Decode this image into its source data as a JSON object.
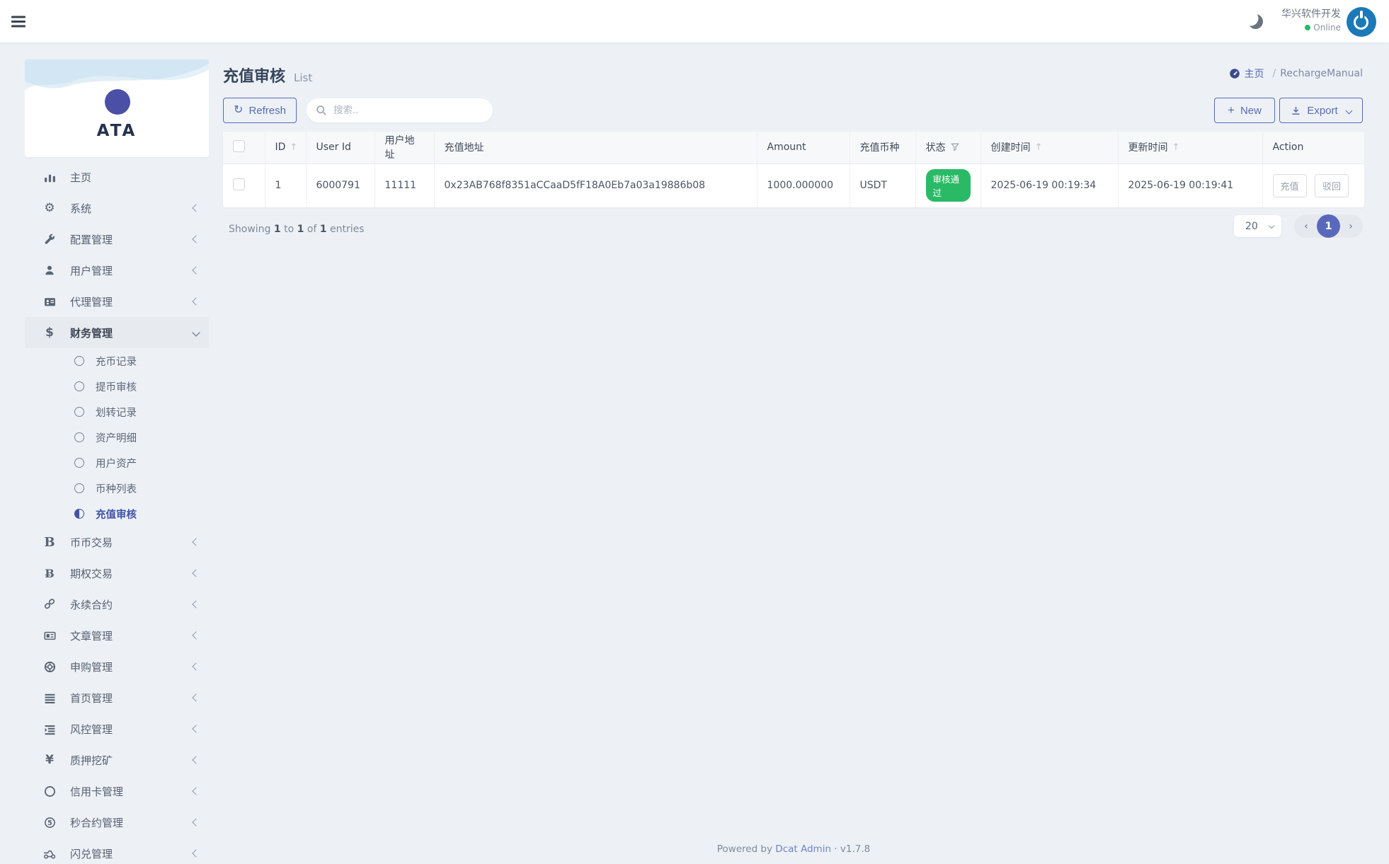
{
  "topbar": {
    "brand": "华兴软件开发",
    "status": "Online"
  },
  "sidebar": {
    "logo": "ATA",
    "items": [
      {
        "label": "主页",
        "icon": "chart-bar"
      },
      {
        "label": "系统",
        "icon": "gear"
      },
      {
        "label": "配置管理",
        "icon": "wrench"
      },
      {
        "label": "用户管理",
        "icon": "user"
      },
      {
        "label": "代理管理",
        "icon": "id-card"
      },
      {
        "label": "财务管理",
        "icon": "dollar",
        "expanded": true,
        "children": [
          {
            "label": "充币记录"
          },
          {
            "label": "提币审核"
          },
          {
            "label": "划转记录"
          },
          {
            "label": "资产明细"
          },
          {
            "label": "用户资产"
          },
          {
            "label": "币种列表"
          },
          {
            "label": "充值审核",
            "active": true
          }
        ]
      },
      {
        "label": "币币交易",
        "icon": "letter-b"
      },
      {
        "label": "期权交易",
        "icon": "bitcoin"
      },
      {
        "label": "永续合约",
        "icon": "chain"
      },
      {
        "label": "文章管理",
        "icon": "newspaper"
      },
      {
        "label": "申购管理",
        "icon": "life-ring"
      },
      {
        "label": "首页管理",
        "icon": "bars"
      },
      {
        "label": "风控管理",
        "icon": "indent"
      },
      {
        "label": "质押挖矿",
        "icon": "yen"
      },
      {
        "label": "信用卡管理",
        "icon": "circle"
      },
      {
        "label": "秒合约管理",
        "icon": "five"
      },
      {
        "label": "闪兑管理",
        "icon": "exchange"
      }
    ]
  },
  "page": {
    "title": "充值审核",
    "subtitle": "List",
    "breadcrumb": {
      "home": "主页",
      "separator": "/",
      "current": "RechargeManual"
    },
    "toolbar": {
      "refresh": "Refresh",
      "search_placeholder": "搜索..",
      "new": "New",
      "export": "Export"
    }
  },
  "table": {
    "headers": {
      "id": "ID",
      "user_id": "User Id",
      "user_addr": "用户地址",
      "recharge_addr": "充值地址",
      "amount": "Amount",
      "coin": "充值币种",
      "status": "状态",
      "created": "创建时间",
      "updated": "更新时间",
      "action": "Action"
    },
    "row": {
      "id": "1",
      "user_id": "6000791",
      "user_addr": "11111",
      "recharge_addr": "0x23AB768f8351aCCaaD5fF18A0Eb7a03a19886b08",
      "amount": "1000.000000",
      "coin": "USDT",
      "status": "审核通过",
      "created": "2025-06-19 00:19:34",
      "updated": "2025-06-19 00:19:41",
      "actions": {
        "recharge": "充值",
        "reject": "驳回"
      }
    }
  },
  "summary": {
    "showing": "Showing",
    "from": "1",
    "to_word": "to",
    "to": "1",
    "of_word": "of",
    "total": "1",
    "entries": "entries"
  },
  "pagination": {
    "page_size": "20",
    "current_page": "1",
    "prev": "‹",
    "next": "›"
  },
  "footer": {
    "powered": "Powered by",
    "product": "Dcat Admin",
    "separator": "·",
    "version": "v1.7.8"
  },
  "colors": {
    "accent": "#586cb1",
    "success": "#2aba66",
    "avatar": "#1b79b8",
    "page_bg": "#edf1f6"
  }
}
